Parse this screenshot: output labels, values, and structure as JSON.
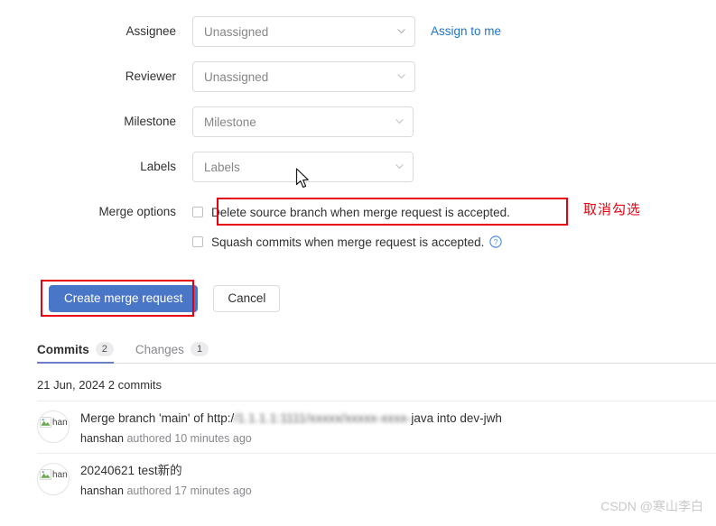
{
  "form": {
    "rows": [
      {
        "label": "Assignee",
        "value": "Unassigned",
        "icon": "chevron-down-icon"
      },
      {
        "label": "Reviewer",
        "value": "Unassigned",
        "icon": "chevron-down-icon"
      },
      {
        "label": "Milestone",
        "value": "Milestone",
        "icon": "chevron-down-icon"
      },
      {
        "label": "Labels",
        "value": "Labels",
        "icon": "chevron-down-icon"
      }
    ],
    "assign_to_me": "Assign to me",
    "merge_options_label": "Merge options",
    "merge_options": [
      {
        "label": "Delete source branch when merge request is accepted.",
        "checked": false,
        "help": false
      },
      {
        "label": "Squash commits when merge request is accepted.",
        "checked": false,
        "help": true
      }
    ]
  },
  "actions": {
    "primary_label": "Create merge request",
    "primary_color": "#4a76c7",
    "cancel_label": "Cancel"
  },
  "annotations": {
    "color": "#e60012",
    "note": "取消勾选"
  },
  "tabs": [
    {
      "label": "Commits",
      "count": "2",
      "active": true
    },
    {
      "label": "Changes",
      "count": "1",
      "active": false
    }
  ],
  "commits": {
    "date_header": "21 Jun, 2024 2 commits",
    "items": [
      {
        "title_prefix": "Merge branch 'main' of http:/",
        "title_redacted": "/1.1.1.1:1111/xxxxx/xxxxx-xxxx-",
        "title_suffix": "java into dev-jwh",
        "author": "hanshan",
        "meta": "authored 10 minutes ago",
        "avatar_alt": "han"
      },
      {
        "title_prefix": "20240621 test新的",
        "title_redacted": "",
        "title_suffix": "",
        "author": "hanshan",
        "meta": "authored 17 minutes ago",
        "avatar_alt": "han"
      }
    ]
  },
  "watermark": "CSDN @寒山李白"
}
